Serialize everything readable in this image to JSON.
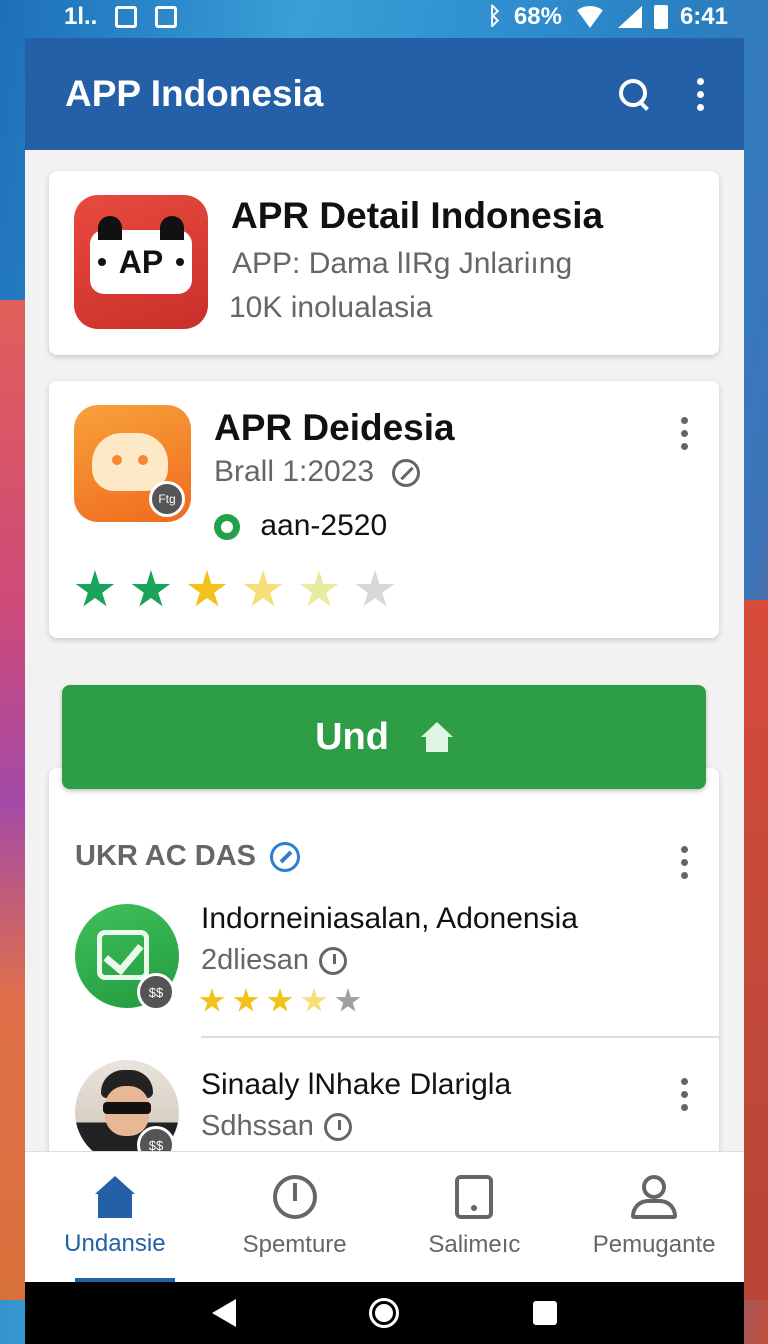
{
  "status_bar": {
    "left_text": "1l..",
    "battery": "68%",
    "time": "6:41"
  },
  "app_bar": {
    "title": "APP Indonesia",
    "icons": [
      "search-icon",
      "more-vert-icon"
    ]
  },
  "featured_app": {
    "icon_text": "AP",
    "title": "APR Detail Indonesia",
    "subtitle": "APP:  Dama lIRg Jnlariıng",
    "downloads": "10K inolualasia"
  },
  "detail_card": {
    "title": "APR  Deidesia",
    "badge_text": "Ftg",
    "date": "Brall 1:2023",
    "code": "aan-2520",
    "stars": [
      "#1aa35a",
      "#1aa35a",
      "#f2c21a",
      "#f8de7a",
      "#e8eca0",
      "#d8d8d8"
    ]
  },
  "primary_button": {
    "label": "Und"
  },
  "section": {
    "title": "UKR AC DAS",
    "items": [
      {
        "title": "Indorneiniasalan, Adonensia",
        "subtitle": "2dliesan",
        "badge_text": "$$",
        "stars": [
          "#f2c21a",
          "#f2c21a",
          "#f2c21a",
          "#f8de7a",
          "#ffffff"
        ]
      },
      {
        "title": "Sinaaly lNhake Dlarigla",
        "subtitle": "Sdhssan",
        "badge_text": "$$"
      }
    ]
  },
  "bottom_nav": {
    "items": [
      {
        "label": "Undansie",
        "icon": "home-icon",
        "active": true
      },
      {
        "label": "Spemture",
        "icon": "timer-icon",
        "active": false
      },
      {
        "label": "Salimeıc",
        "icon": "tablet-icon",
        "active": false
      },
      {
        "label": "Pemugante",
        "icon": "person-icon",
        "active": false
      }
    ]
  },
  "colors": {
    "app_bar": "#2460a7",
    "button": "#2e9e46",
    "active_nav": "#2460a7"
  }
}
